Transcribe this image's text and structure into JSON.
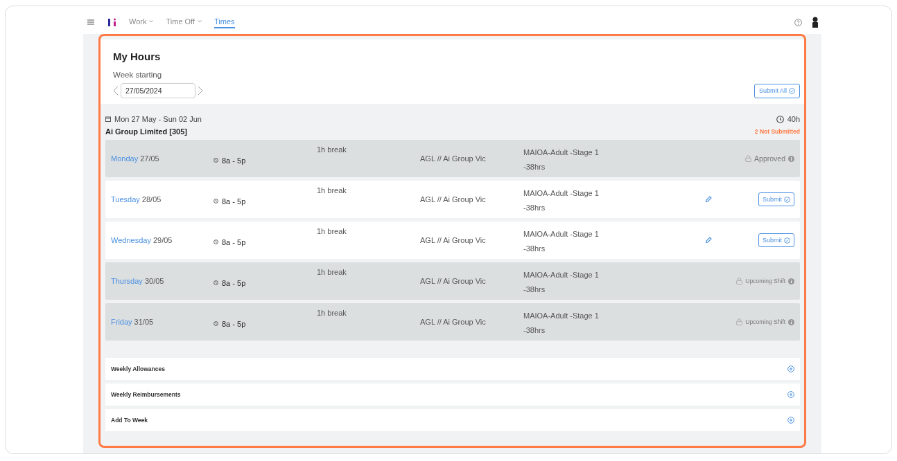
{
  "nav": {
    "tabs": [
      {
        "label": "Work",
        "dropdown": true,
        "selected": false
      },
      {
        "label": "Time Off",
        "dropdown": true,
        "selected": false
      },
      {
        "label": "Times",
        "dropdown": false,
        "selected": true
      }
    ]
  },
  "header": {
    "title": "My Hours",
    "week_label": "Week starting",
    "week_value": "27/05/2024",
    "submit_all": "Submit All"
  },
  "week": {
    "range": "Mon 27 May - Sun 02 Jun",
    "total": "40h",
    "employer": "Ai Group Limited [305]",
    "not_submitted": "2 Not Submitted"
  },
  "rows": [
    {
      "kind": "locked",
      "day": "Monday",
      "date": "27/05",
      "time": "8a - 5p",
      "break": "1h break",
      "location": "AGL // Ai Group Vic",
      "award": "MAIOA-Adult -Stage 1 -38hrs",
      "status": "Approved"
    },
    {
      "kind": "open",
      "day": "Tuesday",
      "date": "28/05",
      "time": "8a - 5p",
      "break": "1h break",
      "location": "AGL // Ai Group Vic",
      "award": "MAIOA-Adult -Stage 1 -38hrs",
      "status": "Submit"
    },
    {
      "kind": "open",
      "day": "Wednesday",
      "date": "29/05",
      "time": "8a - 5p",
      "break": "1h break",
      "location": "AGL // Ai Group Vic",
      "award": "MAIOA-Adult -Stage 1 -38hrs",
      "status": "Submit"
    },
    {
      "kind": "locked",
      "day": "Thursday",
      "date": "30/05",
      "time": "8a - 5p",
      "break": "1h break",
      "location": "AGL // Ai Group Vic",
      "award": "MAIOA-Adult -Stage 1 -38hrs",
      "status": "Upcoming Shift"
    },
    {
      "kind": "locked",
      "day": "Friday",
      "date": "31/05",
      "time": "8a - 5p",
      "break": "1h break",
      "location": "AGL // Ai Group Vic",
      "award": "MAIOA-Adult -Stage 1 -38hrs",
      "status": "Upcoming Shift"
    }
  ],
  "sections": [
    "Weekly Allowances",
    "Weekly Reimbursements",
    "Add To Week"
  ]
}
